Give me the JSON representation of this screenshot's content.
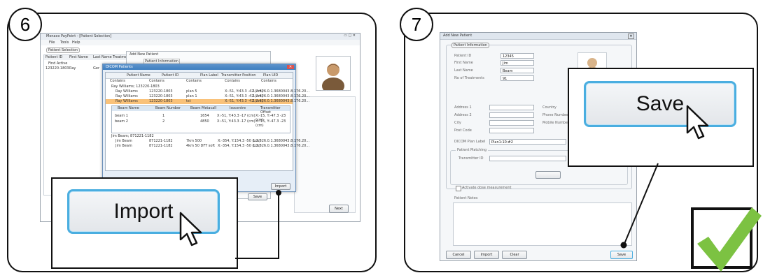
{
  "steps": [
    {
      "number": "6",
      "app": {
        "title": "Monaco PayPoint - [Patient Selection]",
        "menu": [
          "File",
          "Tools",
          "Help"
        ],
        "section": "Patient Selection",
        "columns": [
          "Patient ID",
          "First Name",
          "Last Name",
          "Treatment"
        ],
        "rows": [
          [
            "Find Active",
            "",
            "",
            ""
          ],
          [
            "123220-1803",
            "Ray",
            "Ger",
            ""
          ]
        ],
        "add_patient_title": "Add New Patient",
        "patient_info_tab": "Patient Information",
        "next_label": "Next"
      },
      "dialog": {
        "title": "DICOM Patients",
        "headers": [
          "Patient Name",
          "Patient ID",
          "Plan Label",
          "Transmitter Position",
          "Plan UID"
        ],
        "filter": "Contains",
        "groups": [
          {
            "label": "Ray Williams; 123220-1803",
            "rows": [
              [
                "Ray Williams",
                "123220-1803",
                "plan 5",
                "X:-51, Y:43.3 -42 (cm)",
                "1.2.826.0.1.3680043.8.176.20..."
              ],
              [
                "Ray Williams",
                "123220-1803",
                "plan 1",
                "X:-51, Y:43.3 -42 (cm)",
                "1.2.826.0.1.3680043.8.176.20..."
              ],
              [
                "Ray Williams",
                "123220-1803",
                "tst",
                "X:-51, Y:43.3 -42 (cm)",
                "1.2.826.0.1.3680043.8.176.20..."
              ]
            ]
          },
          {
            "label": "Jim Beam; 871221-1182",
            "rows": [
              [
                "Jim Beam",
                "871221-1182",
                "7km 500",
                "X:-354, Y:154.3 -50 (cm)",
                "1.2.826.0.1.3680043.8.176.20..."
              ],
              [
                "Jim Beam",
                "871221-1182",
                "4km 50 DFT soft",
                "X:-354, Y:154.3 -50 (cm)",
                "1.2.826.0.1.3680043.8.176.20..."
              ]
            ]
          }
        ],
        "beam_headers": [
          "Beam Name",
          "Beam Number",
          "Beam Metacall",
          "Isocentre",
          "Transmitter Offset"
        ],
        "beams": [
          [
            "beam 1",
            "1",
            "1654",
            "X:-51, Y:43.3 -17 (cm)",
            "X:-15, Y:-47.3 -23 (cm)"
          ],
          [
            "beam 2",
            "2",
            "4850",
            "X:-51, Y:43.3 -17 (cm)",
            "X:-15, Y:-47.3 -23 (cm)"
          ]
        ],
        "import_small": "Import",
        "save_small": "Save"
      },
      "callout_label": "Import"
    },
    {
      "number": "7",
      "form": {
        "title": "Add New Patient",
        "group": "Patient Information",
        "fields": [
          {
            "label": "Patient ID",
            "value": "12345"
          },
          {
            "label": "First Name",
            "value": "Jim"
          },
          {
            "label": "Last Name",
            "value": "Beam"
          },
          {
            "label": "No of Treatments",
            "value": "91"
          }
        ],
        "address_labels": [
          "Address 1",
          "Address 2",
          "City",
          "Post Code"
        ],
        "right_labels": [
          "Country",
          "Phone Number",
          "Mobile Number"
        ],
        "dicom_label": "DICOM Plan Label",
        "dicom_value": "Plan1:10:#2",
        "matching_group": "Patient Matching",
        "transmitter_label": "Transmitter ID",
        "checkbox_label": "Activate dose measurement",
        "notes_label": "Patient Notes",
        "buttons": {
          "cancel": "Cancel",
          "import": "Import",
          "clear": "Clear",
          "save": "Save"
        }
      },
      "callout_label": "Save"
    }
  ],
  "colors": {
    "accent": "#4aaee0",
    "check": "#7cc242",
    "highlight": "#f9c27a",
    "dialog_header": "#3f7fc0"
  }
}
